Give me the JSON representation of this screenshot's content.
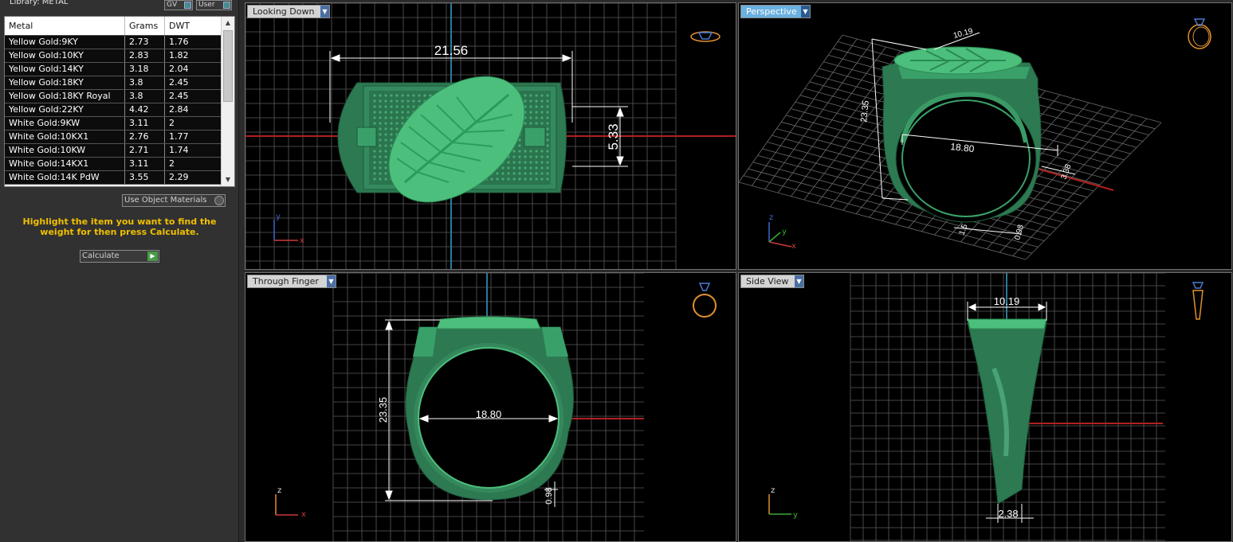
{
  "library": {
    "title": "Library: METAL",
    "gv_label": "GV",
    "user_label": "User"
  },
  "table": {
    "headers": [
      "Metal",
      "Grams",
      "DWT"
    ],
    "rows": [
      [
        "Yellow Gold:9KY",
        "2.73",
        "1.76"
      ],
      [
        "Yellow Gold:10KY",
        "2.83",
        "1.82"
      ],
      [
        "Yellow Gold:14KY",
        "3.18",
        "2.04"
      ],
      [
        "Yellow Gold:18KY",
        "3.8",
        "2.45"
      ],
      [
        "Yellow Gold:18KY Royal",
        "3.8",
        "2.45"
      ],
      [
        "Yellow Gold:22KY",
        "4.42",
        "2.84"
      ],
      [
        "White Gold:9KW",
        "3.11",
        "2"
      ],
      [
        "White Gold:10KX1",
        "2.76",
        "1.77"
      ],
      [
        "White Gold:10KW",
        "2.71",
        "1.74"
      ],
      [
        "White Gold:14KX1",
        "3.11",
        "2"
      ],
      [
        "White Gold:14K PdW",
        "3.55",
        "2.29"
      ]
    ]
  },
  "object_materials_label": "Use Object Materials",
  "hint_text": "Highlight the item you want to find the weight for then press Calculate.",
  "calculate_label": "Calculate",
  "viewports": {
    "looking_down": {
      "label": "Looking Down",
      "dim_width": "21.56",
      "dim_height": "5.33",
      "axis_y": "y",
      "axis_x": "x"
    },
    "perspective": {
      "label": "Perspective",
      "dim_top": "10.19",
      "dim_height": "23.35",
      "dim_inner": "18.80",
      "dim_side": "3.38",
      "dim_bottom": "0.98",
      "dim_base": "1.5",
      "axis_z": "z",
      "axis_y": "y",
      "axis_x": "x"
    },
    "through_finger": {
      "label": "Through Finger",
      "dim_height": "23.35",
      "dim_inner": "18.80",
      "dim_bottom": "0.98",
      "axis_z": "z",
      "axis_x": "x"
    },
    "side_view": {
      "label": "Side View",
      "dim_top": "10.19",
      "dim_bottom": "2.38",
      "axis_z": "z",
      "axis_y": "y"
    }
  },
  "colors": {
    "ring": "#2f8a5a",
    "ring_light": "#5fc98a",
    "grid": "#5a5a5a",
    "axis_red": "#c02020",
    "axis_blue": "#2a7a9a",
    "accent": "#6ab0e0"
  }
}
